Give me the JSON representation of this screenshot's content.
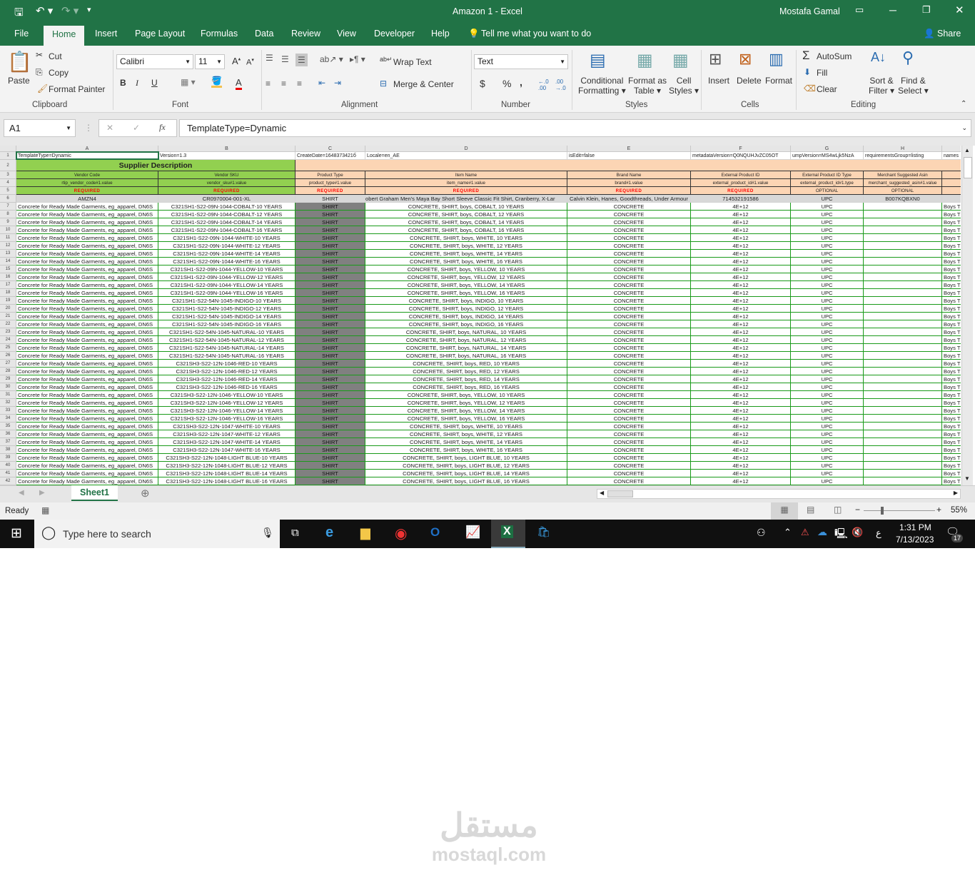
{
  "window": {
    "title": "Amazon 1  -  Excel",
    "user": "Mostafa Gamal",
    "share": "Share"
  },
  "tabs": [
    "File",
    "Home",
    "Insert",
    "Page Layout",
    "Formulas",
    "Data",
    "Review",
    "View",
    "Developer",
    "Help"
  ],
  "tell_me": "Tell me what you want to do",
  "ribbon": {
    "clipboard": {
      "paste": "Paste",
      "cut": "Cut",
      "copy": "Copy",
      "format_painter": "Format Painter",
      "label": "Clipboard"
    },
    "font": {
      "name": "Calibri",
      "size": "11",
      "bold": "B",
      "italic": "I",
      "underline": "U",
      "label": "Font"
    },
    "alignment": {
      "wrap": "Wrap Text",
      "merge": "Merge & Center",
      "label": "Alignment"
    },
    "number": {
      "format": "Text",
      "currency": "$",
      "percent": "%",
      "comma": ",",
      "label": "Number"
    },
    "styles": {
      "conditional": "Conditional",
      "conditional2": "Formatting",
      "format_table": "Format as",
      "format_table2": "Table",
      "cell_styles": "Cell",
      "cell_styles2": "Styles",
      "label": "Styles"
    },
    "cells": {
      "insert": "Insert",
      "delete": "Delete",
      "format": "Format",
      "label": "Cells"
    },
    "editing": {
      "autosum": "AutoSum",
      "fill": "Fill",
      "clear": "Clear",
      "sort": "Sort &",
      "sort2": "Filter",
      "find": "Find &",
      "find2": "Select",
      "label": "Editing"
    }
  },
  "formula_bar": {
    "name_box": "A1",
    "fx": "fx",
    "value": "TemplateType=Dynamic"
  },
  "columns": [
    "A",
    "B",
    "C",
    "D",
    "E",
    "F",
    "G",
    "H"
  ],
  "row1": [
    "TemplateType=Dynamic",
    "Version=1.3",
    "CreateDate=1648373421б",
    "Locale=en_AE",
    "isEdit=false",
    "metadataVersion=Q0NQUHJvZC05OT",
    "umpVersion=MS4wLjk5NzA",
    "requirementsGroup=listing",
    "names"
  ],
  "row2": {
    "title": "Supplier Description"
  },
  "row3": [
    "Vendor Code",
    "Vendor SKU",
    "Product Type",
    "Item Name",
    "Brand Name",
    "External Product ID",
    "External Product ID Type",
    "Merchant Suggested Asin",
    ""
  ],
  "row4": [
    "rtip_vendor_code#1.value",
    "vendor_sku#1.value",
    "product_type#1.value",
    "item_name#1.value",
    "brand#1.value",
    "external_product_id#1.value",
    "external_product_id#1.type",
    "merchant_suggested_asin#1.value",
    "pro"
  ],
  "row5": [
    "REQUIRED",
    "REQUIRED",
    "REQUIRED",
    "REQUIRED",
    "REQUIRED",
    "REQUIRED",
    "OPTIONAL",
    "OPTIONAL",
    ""
  ],
  "row6": [
    "AMZN4",
    "CR0970004-001-XL",
    "SHIRT",
    "obert Graham Men's Maya Bay Short Sleeve Classic Fit Shirt, Cranberry, X-Lar",
    "Calvin Klein, Hanes, Goodthreads, Under Armour",
    "714532191586",
    "UPC",
    "B007KQBXN0",
    ""
  ],
  "data_common": {
    "a": "Concrete for Ready Made Garments, eg_apparel, DN6S",
    "c": "SHIRT",
    "e": "CONCRETE",
    "f": "4E+12",
    "g": "UPC",
    "h": "",
    "i": "Boys T"
  },
  "data_rows": [
    [
      "C321SH1-S22-09N-1044-COBALT-10 YEARS",
      "CONCRETE, SHIRT, boys, COBALT, 10 YEARS"
    ],
    [
      "C321SH1-S22-09N-1044-COBALT-12 YEARS",
      "CONCRETE, SHIRT, boys, COBALT, 12 YEARS"
    ],
    [
      "C321SH1-S22-09N-1044-COBALT-14 YEARS",
      "CONCRETE, SHIRT, boys, COBALT, 14 YEARS"
    ],
    [
      "C321SH1-S22-09N-1044-COBALT-16 YEARS",
      "CONCRETE, SHIRT, boys, COBALT, 16 YEARS"
    ],
    [
      "C321SH1-S22-09N-1044-WHITE-10 YEARS",
      "CONCRETE, SHIRT, boys, WHITE, 10 YEARS"
    ],
    [
      "C321SH1-S22-09N-1044-WHITE-12 YEARS",
      "CONCRETE, SHIRT, boys, WHITE, 12 YEARS"
    ],
    [
      "C321SH1-S22-09N-1044-WHITE-14 YEARS",
      "CONCRETE, SHIRT, boys, WHITE, 14 YEARS"
    ],
    [
      "C321SH1-S22-09N-1044-WHITE-16 YEARS",
      "CONCRETE, SHIRT, boys, WHITE, 16 YEARS"
    ],
    [
      "C321SH1-S22-09N-1044-YELLOW-10 YEARS",
      "CONCRETE, SHIRT, boys, YELLOW, 10 YEARS"
    ],
    [
      "C321SH1-S22-09N-1044-YELLOW-12 YEARS",
      "CONCRETE, SHIRT, boys, YELLOW, 12 YEARS"
    ],
    [
      "C321SH1-S22-09N-1044-YELLOW-14 YEARS",
      "CONCRETE, SHIRT, boys, YELLOW, 14 YEARS"
    ],
    [
      "C321SH1-S22-09N-1044-YELLOW-16 YEARS",
      "CONCRETE, SHIRT, boys, YELLOW, 16 YEARS"
    ],
    [
      "C321SH1-S22-54N-1045-INDIGO-10 YEARS",
      "CONCRETE, SHIRT, boys, INDIGO, 10 YEARS"
    ],
    [
      "C321SH1-S22-54N-1045-INDIGO-12 YEARS",
      "CONCRETE, SHIRT, boys, INDIGO, 12 YEARS"
    ],
    [
      "C321SH1-S22-54N-1045-INDIGO-14 YEARS",
      "CONCRETE, SHIRT, boys, INDIGO, 14 YEARS"
    ],
    [
      "C321SH1-S22-54N-1045-INDIGO-16 YEARS",
      "CONCRETE, SHIRT, boys, INDIGO, 16 YEARS"
    ],
    [
      "C321SH1-S22-54N-1045-NATURAL-10 YEARS",
      "CONCRETE, SHIRT, boys, NATURAL, 10 YEARS"
    ],
    [
      "C321SH1-S22-54N-1045-NATURAL-12 YEARS",
      "CONCRETE, SHIRT, boys, NATURAL, 12 YEARS"
    ],
    [
      "C321SH1-S22-54N-1045-NATURAL-14 YEARS",
      "CONCRETE, SHIRT, boys, NATURAL, 14 YEARS"
    ],
    [
      "C321SH1-S22-54N-1045-NATURAL-16 YEARS",
      "CONCRETE, SHIRT, boys, NATURAL, 16 YEARS"
    ],
    [
      "C321SH3-S22-12N-1046-RED-10 YEARS",
      "CONCRETE, SHIRT, boys, RED, 10 YEARS"
    ],
    [
      "C321SH3-S22-12N-1046-RED-12 YEARS",
      "CONCRETE, SHIRT, boys, RED, 12 YEARS"
    ],
    [
      "C321SH3-S22-12N-1046-RED-14 YEARS",
      "CONCRETE, SHIRT, boys, RED, 14 YEARS"
    ],
    [
      "C321SH3-S22-12N-1046-RED-16 YEARS",
      "CONCRETE, SHIRT, boys, RED, 16 YEARS"
    ],
    [
      "C321SH3-S22-12N-1046-YELLOW-10 YEARS",
      "CONCRETE, SHIRT, boys, YELLOW, 10 YEARS"
    ],
    [
      "C321SH3-S22-12N-1046-YELLOW-12 YEARS",
      "CONCRETE, SHIRT, boys, YELLOW, 12 YEARS"
    ],
    [
      "C321SH3-S22-12N-1046-YELLOW-14 YEARS",
      "CONCRETE, SHIRT, boys, YELLOW, 14 YEARS"
    ],
    [
      "C321SH3-S22-12N-1046-YELLOW-16 YEARS",
      "CONCRETE, SHIRT, boys, YELLOW, 16 YEARS"
    ],
    [
      "C321SH3-S22-12N-1047-WHITE-10 YEARS",
      "CONCRETE, SHIRT, boys, WHITE, 10 YEARS"
    ],
    [
      "C321SH3-S22-12N-1047-WHITE-12 YEARS",
      "CONCRETE, SHIRT, boys, WHITE, 12 YEARS"
    ],
    [
      "C321SH3-S22-12N-1047-WHITE-14 YEARS",
      "CONCRETE, SHIRT, boys, WHITE, 14 YEARS"
    ],
    [
      "C321SH3-S22-12N-1047-WHITE-16 YEARS",
      "CONCRETE, SHIRT, boys, WHITE, 16 YEARS"
    ],
    [
      "C321SH3-S22-12N-1048-LIGHT BLUE-10 YEARS",
      "CONCRETE, SHIRT, boys, LIGHT BLUE, 10 YEARS"
    ],
    [
      "C321SH3-S22-12N-1048-LIGHT BLUE-12 YEARS",
      "CONCRETE, SHIRT, boys, LIGHT BLUE, 12 YEARS"
    ],
    [
      "C321SH3-S22-12N-1048-LIGHT BLUE-14 YEARS",
      "CONCRETE, SHIRT, boys, LIGHT BLUE, 14 YEARS"
    ],
    [
      "C321SH3-S22-12N-1048-LIGHT BLUE-16 YEARS",
      "CONCRETE, SHIRT, boys, LIGHT BLUE, 16 YEARS"
    ]
  ],
  "sheet_tab": "Sheet1",
  "status": {
    "ready": "Ready",
    "zoom": "55%",
    "zoom_level": 55
  },
  "taskbar": {
    "search": "Type here to search",
    "time": "1:31 PM",
    "date": "7/13/2023",
    "notifications": "17",
    "lang": "ع"
  },
  "watermark": {
    "arabic": "مستقل",
    "latin": "mostaql.com"
  },
  "colors": {
    "excel_green": "#217346",
    "header_green": "#92d050",
    "header_peach": "#fcd5b4",
    "required_red": "#ff0000"
  }
}
